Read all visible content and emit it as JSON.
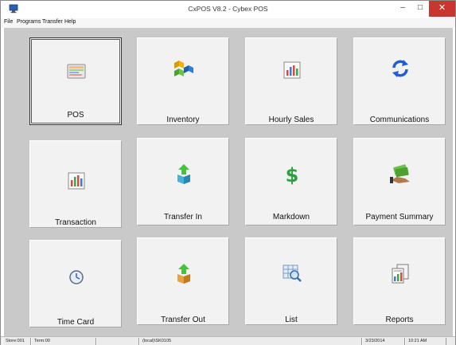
{
  "window": {
    "title": "CxPOS V8.2 - Cybex POS",
    "minimize_glyph": "–",
    "maximize_glyph": "□",
    "close_glyph": "✕"
  },
  "menu": {
    "items": [
      {
        "label": "File"
      },
      {
        "label": "Programs"
      },
      {
        "label": "Transfer"
      },
      {
        "label": "Help"
      }
    ]
  },
  "tiles": [
    {
      "label": "POS",
      "icon": "pos-screen-icon"
    },
    {
      "label": "Inventory",
      "icon": "inventory-cubes-icon"
    },
    {
      "label": "Hourly Sales",
      "icon": "bar-chart-icon"
    },
    {
      "label": "Communications",
      "icon": "sync-arrows-icon"
    },
    {
      "label": "Transaction",
      "icon": "transaction-chart-icon"
    },
    {
      "label": "Transfer In",
      "icon": "box-arrow-in-icon"
    },
    {
      "label": "Markdown",
      "icon": "dollar-sign-icon"
    },
    {
      "label": "Payment Summary",
      "icon": "money-hand-icon"
    },
    {
      "label": "Time Card",
      "icon": "clock-icon"
    },
    {
      "label": "Transfer Out",
      "icon": "box-arrow-out-icon"
    },
    {
      "label": "List",
      "icon": "list-magnifier-icon"
    },
    {
      "label": "Reports",
      "icon": "report-document-icon"
    }
  ],
  "status": {
    "store": "Store:001",
    "term": "Term:00",
    "blank": "",
    "server": "(local)\\SK0105",
    "date": "3/23/2014",
    "time": "10:21 AM"
  },
  "colors": {
    "workspace": "#c9c9c9",
    "tile": "#f2f2f2",
    "close": "#c7372f"
  }
}
